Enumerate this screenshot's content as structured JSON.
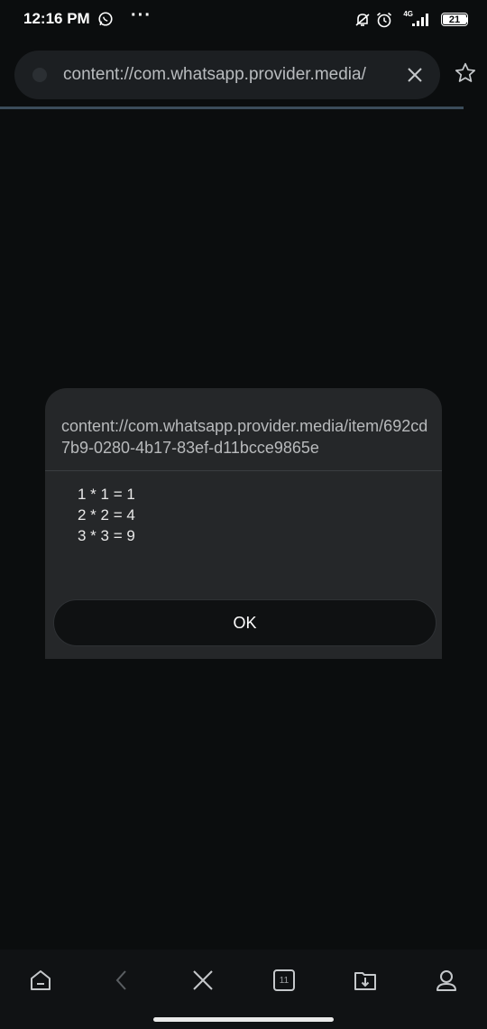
{
  "status_bar": {
    "time": "12:16 PM",
    "more": "···",
    "network": "4G",
    "battery": "21"
  },
  "browser": {
    "url": "content://com.whatsapp.provider.media/"
  },
  "dialog": {
    "title": "content://com.whatsapp.provider.media/item/692cd7b9-0280-4b17-83ef-d11bcce9865e",
    "message_lines": [
      "1 * 1 = 1",
      "2 * 2 = 4",
      "3 * 3 = 9"
    ],
    "ok_label": "OK"
  },
  "bottom_nav": {
    "tabs_count": "11",
    "items": [
      "home-icon",
      "back-icon",
      "close-icon",
      "tabs-icon",
      "downloads-icon",
      "profile-icon"
    ]
  },
  "colors": {
    "background": "#0b0d0e",
    "dialog": "#252729",
    "address_bar": "#1c1f22"
  }
}
